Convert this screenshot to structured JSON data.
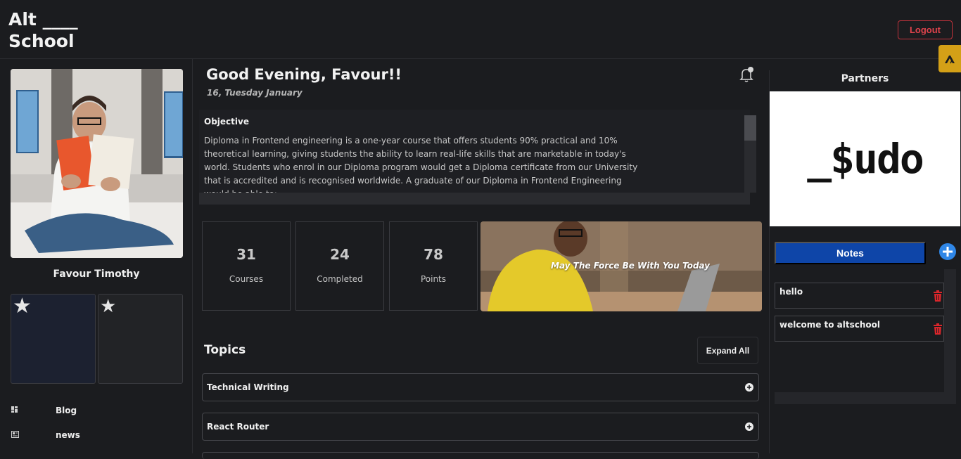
{
  "header": {
    "logo_line1": "Alt ____",
    "logo_line2": "School",
    "logout_label": "Logout"
  },
  "sidebar": {
    "profile_name": "Favour Timothy",
    "star_cards": [
      "star-icon",
      "star-icon"
    ],
    "nav": [
      {
        "icon": "dashboard-icon",
        "label": "Blog"
      },
      {
        "icon": "newspaper-icon",
        "label": "news"
      }
    ]
  },
  "main": {
    "greeting": "Good Evening, Favour!!",
    "date": "16, Tuesday January",
    "objective": {
      "title": "Objective",
      "text": "Diploma in Frontend engineering is a one-year course that offers students 90% practical and 10% theoretical learning, giving students the ability to learn real-life skills that are marketable in today's world. Students who enrol in our Diploma program would get a Diploma certificate from our University that is accredited and is recognised worldwide. A graduate of our Diploma in Frontend Engineering would be able to:"
    },
    "stats": [
      {
        "value": "31",
        "caption": "Courses"
      },
      {
        "value": "24",
        "caption": "Completed"
      },
      {
        "value": "78",
        "caption": "Points"
      }
    ],
    "promo_text": "May The Force Be With You Today",
    "topics_title": "Topics",
    "expand_label": "Expand All",
    "topics": [
      "Technical Writing",
      "React Router"
    ]
  },
  "right": {
    "partners_title": "Partners",
    "partner_logo_text": "_$udo",
    "notes_label": "Notes",
    "notes": [
      "hello",
      "welcome to altschool"
    ]
  },
  "colors": {
    "background": "#1b1c1f",
    "logout": "#e0434c",
    "notes_button": "#0e45a8",
    "add_icon": "#2f86e6",
    "trash": "#d9262b",
    "badge": "#d4a017"
  }
}
